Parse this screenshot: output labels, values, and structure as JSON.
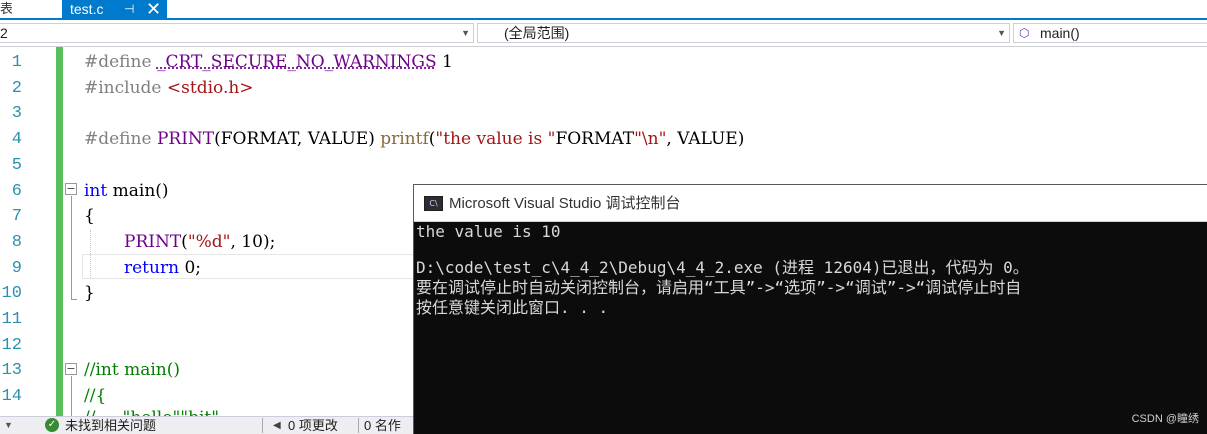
{
  "tabs": {
    "previous_fragment": "表",
    "active": {
      "label": "test.c",
      "pin_glyph": "⊣",
      "close_glyph": "✕"
    }
  },
  "navbar": {
    "project": "2",
    "scope": "(全局范围)",
    "member": "main()"
  },
  "editor": {
    "lines": [
      {
        "num": "1"
      },
      {
        "num": "2"
      },
      {
        "num": "3"
      },
      {
        "num": "4"
      },
      {
        "num": "5"
      },
      {
        "num": "6"
      },
      {
        "num": "7"
      },
      {
        "num": "8"
      },
      {
        "num": "9"
      },
      {
        "num": "10"
      },
      {
        "num": "11"
      },
      {
        "num": "12"
      },
      {
        "num": "13"
      },
      {
        "num": "14"
      }
    ],
    "code": {
      "l1": [
        "#define",
        " ",
        "_CRT_SECURE_NO_WARNINGS",
        " 1"
      ],
      "l2": [
        "#include",
        " ",
        "<stdio.h>"
      ],
      "l4": [
        "#define",
        " ",
        "PRINT",
        "(FORMAT, VALUE) ",
        "printf",
        "(",
        "\"the value is \"",
        "FORMAT",
        "\"\\n\"",
        ", VALUE)"
      ],
      "l6": [
        "int",
        " main()"
      ],
      "l7": [
        "{"
      ],
      "l8": [
        "PRINT",
        "(",
        "\"%d\"",
        ", 10);"
      ],
      "l9": [
        "return",
        " 0;"
      ],
      "l10": [
        "}"
      ],
      "l13": [
        "//int main()"
      ],
      "l14": [
        "//{"
      ],
      "l15": [
        "//",
        "     ",
        "\"hello\"",
        "",
        "\"bit\"",
        ""
      ]
    }
  },
  "console": {
    "title": "Microsoft Visual Studio 调试控制台",
    "icon_text": "C\\",
    "lines": [
      "the value is 10",
      "",
      "D:\\code\\test_c\\4_4_2\\Debug\\4_4_2.exe (进程 12604)已退出，代码为 0。",
      "要在调试停止时自动关闭控制台，请启用“工具”->“选项”->“调试”->“调试停止时自",
      "按任意键关闭此窗口. . ."
    ],
    "watermark": "CSDN @瞳绣"
  },
  "statusbar": {
    "issues": "未找到相关问题",
    "changes": "0 项更改",
    "names_prefix": "0 名作"
  },
  "colors": {
    "accent": "#007acc",
    "change_bar": "#57c05a",
    "line_number": "#2b91af",
    "keyword": "#0000ff",
    "macro": "#6f008a",
    "string": "#a31515",
    "comment": "#008000",
    "console_bg": "#0c0c0c"
  }
}
